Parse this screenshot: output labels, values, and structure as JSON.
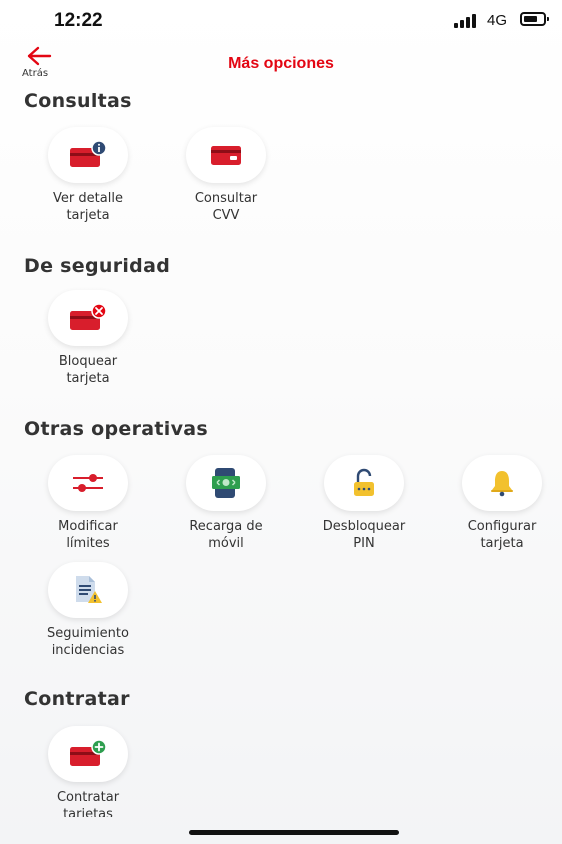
{
  "status": {
    "time": "12:22",
    "network": "4G"
  },
  "header": {
    "back_label": "Atrás",
    "title": "Más opciones"
  },
  "sections": {
    "consultas": {
      "title": "Consultas",
      "items": [
        {
          "label": "Ver detalle\ntarjeta",
          "icon": "card-info-icon"
        },
        {
          "label": "Consultar\nCVV",
          "icon": "card-icon"
        }
      ]
    },
    "seguridad": {
      "title": "De seguridad",
      "items": [
        {
          "label": "Bloquear\ntarjeta",
          "icon": "card-block-icon"
        }
      ]
    },
    "otras": {
      "title": "Otras operativas",
      "items": [
        {
          "label": "Modificar\nlímites",
          "icon": "sliders-icon"
        },
        {
          "label": "Recarga de\nmóvil",
          "icon": "mobile-topup-icon"
        },
        {
          "label": "Desbloquear\nPIN",
          "icon": "unlock-icon"
        },
        {
          "label": "Configurar\ntarjeta",
          "icon": "bell-icon"
        },
        {
          "label": "Seguimiento\nincidencias",
          "icon": "document-warning-icon"
        }
      ]
    },
    "contratar": {
      "title": "Contratar",
      "items": [
        {
          "label": "Contratar\ntarietas",
          "icon": "card-add-icon"
        }
      ]
    }
  },
  "colors": {
    "brand_red": "#e30613",
    "card_red": "#d81e2c",
    "icon_blue": "#2f4a73",
    "icon_green": "#2e9e4f",
    "icon_yellow": "#f2c12e"
  }
}
